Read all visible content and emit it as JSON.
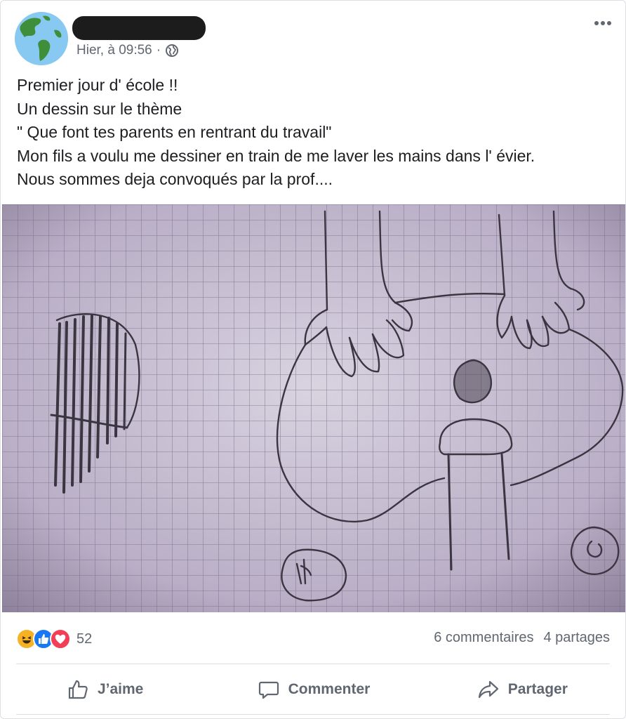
{
  "post": {
    "timestamp": "Hier, à 09:56",
    "separator": "·",
    "privacy_icon": "globe-icon",
    "text_lines": [
      "Premier jour d' école !!",
      "Un dessin sur le thème",
      "\" Que font tes parents en rentrant du travail\"",
      "Mon fils a voulu me dessiner en train de me laver les mains dans l' évier.",
      "Nous sommes deja convoqués par la prof...."
    ]
  },
  "stats": {
    "reaction_icons": [
      "haha-icon",
      "like-icon",
      "love-icon"
    ],
    "reaction_count": "52",
    "comments": "6 commentaires",
    "shares": "4 partages"
  },
  "actions": {
    "like_label": "J’aime",
    "comment_label": "Commenter",
    "share_label": "Partager"
  },
  "colors": {
    "accent": "#1877f2",
    "muted_text": "#606770",
    "text": "#1c1e21"
  }
}
